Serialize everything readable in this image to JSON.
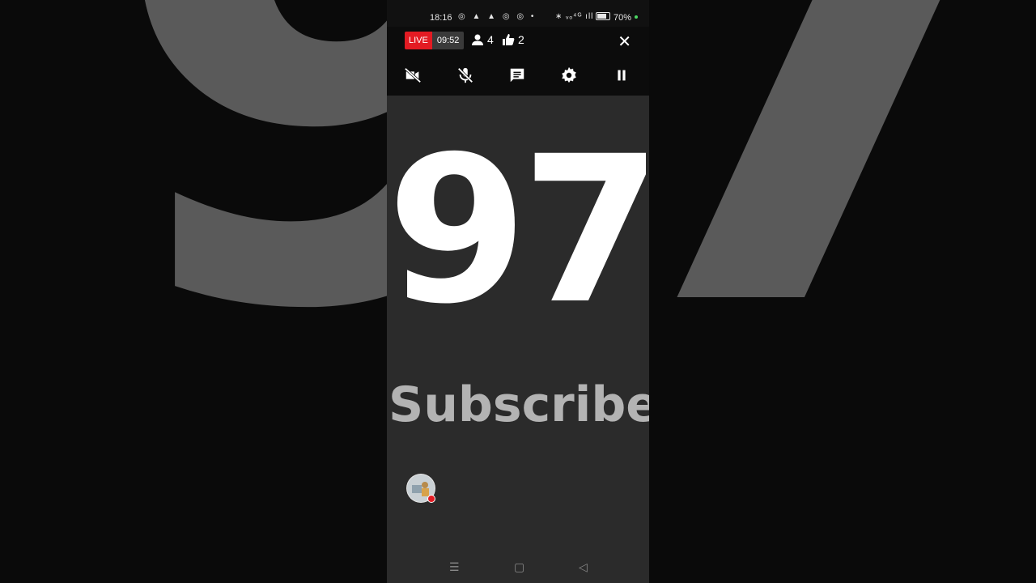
{
  "background": {
    "number": "97"
  },
  "status_bar": {
    "time": "18:16",
    "notifications": "◎ ▲ ▲ ◎ ◎ •",
    "signal": "∗ ᵥₒ⁴ᴳ ıll",
    "battery_percent": "70%"
  },
  "live_bar": {
    "live_label": "LIVE",
    "timer": "09:52",
    "viewers": "4",
    "likes": "2",
    "close_icon": "✕"
  },
  "toolbar": {
    "icons": [
      "camera-off",
      "mic-off",
      "chat",
      "settings",
      "pause"
    ]
  },
  "content": {
    "count": "97",
    "label": "Subscribers"
  },
  "nav": {
    "menu": "☰",
    "home": "▢",
    "back": "◁"
  }
}
